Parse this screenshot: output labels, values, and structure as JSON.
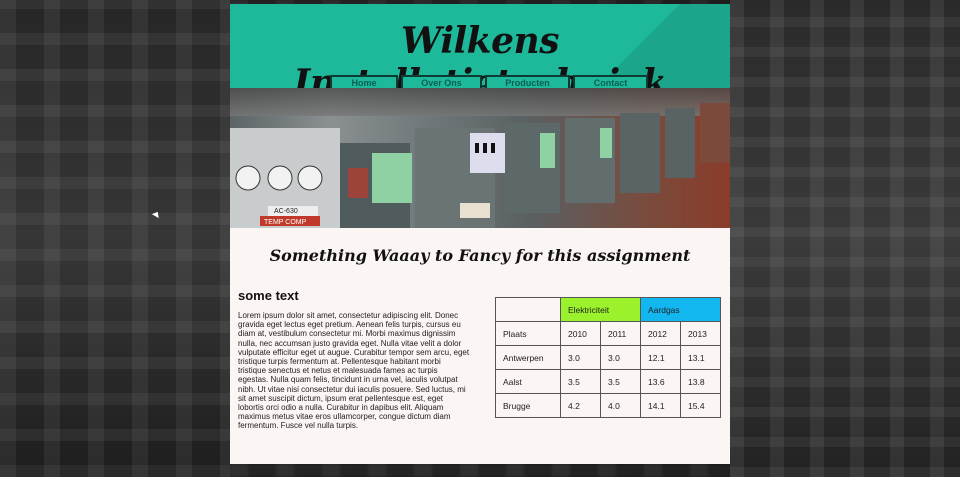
{
  "header": {
    "title": "Wilkens Installatietechniek",
    "brand_color": "#1eb89a"
  },
  "nav": {
    "items": [
      {
        "label": "Home"
      },
      {
        "label": "Over Ons"
      },
      {
        "label": "Producten"
      },
      {
        "label": "Contact"
      }
    ]
  },
  "hero": {
    "meter_label_1": "AC-630",
    "meter_label_2": "TEMP COMP"
  },
  "main": {
    "tagline": "Something Waaay to Fancy for this assignment",
    "section_title": "some text",
    "body_text": "Lorem ipsum dolor sit amet, consectetur adipiscing elit. Donec gravida eget lectus eget pretium. Aenean felis turpis, cursus eu diam at, vestibulum consectetur mi. Morbi maximus dignissim nulla, nec accumsan justo gravida eget. Nulla vitae velit a dolor vulputate efficitur eget ut augue. Curabitur tempor sem arcu, eget tristique turpis fermentum at. Pellentesque habitant morbi tristique senectus et netus et malesuada fames ac turpis egestas. Nulla quam felis, tincidunt in urna vel, iaculis volutpat nibh. Ut vitae nisi consectetur dui iaculis posuere. Sed luctus, mi sit amet suscipit dictum, ipsum erat pellentesque est, eget lobortis orci odio a nulla. Curabitur in dapibus elit. Aliquam maximus metus vitae eros ullamcorper, congue dictum diam fermentum. Fusce vel nulla turpis."
  },
  "table": {
    "group_headers": [
      {
        "label": "Elektriciteit",
        "color": "#9bf12b"
      },
      {
        "label": "Aardgas",
        "color": "#12b7f0"
      }
    ],
    "col_headers": [
      "Plaats",
      "2010",
      "2011",
      "2012",
      "2013"
    ],
    "rows": [
      [
        "Antwerpen",
        "3.0",
        "3.0",
        "12.1",
        "13.1"
      ],
      [
        "Aalst",
        "3.5",
        "3.5",
        "13.6",
        "13.8"
      ],
      [
        "Brugge",
        "4.2",
        "4.0",
        "14.1",
        "15.4"
      ]
    ]
  }
}
